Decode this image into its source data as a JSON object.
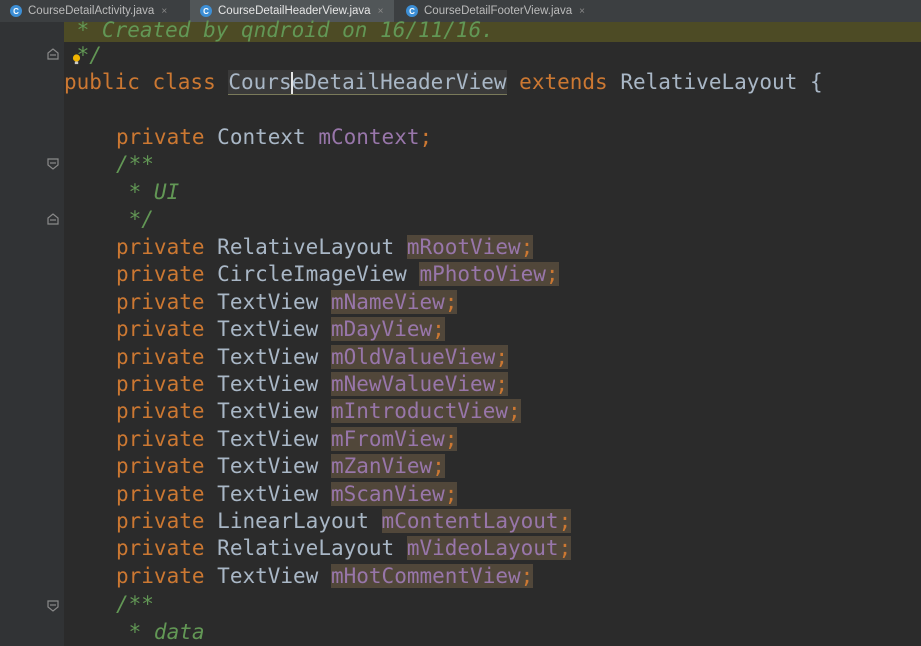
{
  "tabs": [
    {
      "label": "CourseDetailActivity.java",
      "icon": "C",
      "active": false
    },
    {
      "label": "CourseDetailHeaderView.java",
      "icon": "C",
      "active": true
    },
    {
      "label": "CourseDetailFooterView.java",
      "icon": "C",
      "active": false
    }
  ],
  "tab_close_glyph": "×",
  "code": {
    "comment_created": " * Created by qndroid on 16/11/16.",
    "comment_end": " */",
    "class_kw": "public class ",
    "class_name_a": "Cours",
    "class_name_b": "eDetailHeaderView",
    "extends_kw": " extends ",
    "super_class": "RelativeLayout {",
    "kw_private": "private",
    "field_context_type": "Context",
    "field_context_name": "mContext",
    "semicolon": ";",
    "doc_start": "/**",
    "doc_ui": " * UI",
    "doc_end": " */",
    "fields": [
      {
        "type": "RelativeLayout",
        "name": "mRootView"
      },
      {
        "type": "CircleImageView",
        "name": "mPhotoView"
      },
      {
        "type": "TextView",
        "name": "mNameView"
      },
      {
        "type": "TextView",
        "name": "mDayView"
      },
      {
        "type": "TextView",
        "name": "mOldValueView"
      },
      {
        "type": "TextView",
        "name": "mNewValueView"
      },
      {
        "type": "TextView",
        "name": "mIntroductView"
      },
      {
        "type": "TextView",
        "name": "mFromView"
      },
      {
        "type": "TextView",
        "name": "mZanView"
      },
      {
        "type": "TextView",
        "name": "mScanView"
      },
      {
        "type": "LinearLayout",
        "name": "mContentLayout"
      },
      {
        "type": "RelativeLayout",
        "name": "mVideoLayout"
      },
      {
        "type": "TextView",
        "name": "mHotCommentView"
      }
    ],
    "doc_start2": "/**",
    "doc_data": " * data"
  },
  "colors": {
    "background": "#2b2b2b",
    "keyword": "#cc7832",
    "field": "#9876aa",
    "doc_comment": "#629755",
    "text": "#a9b7c6"
  }
}
